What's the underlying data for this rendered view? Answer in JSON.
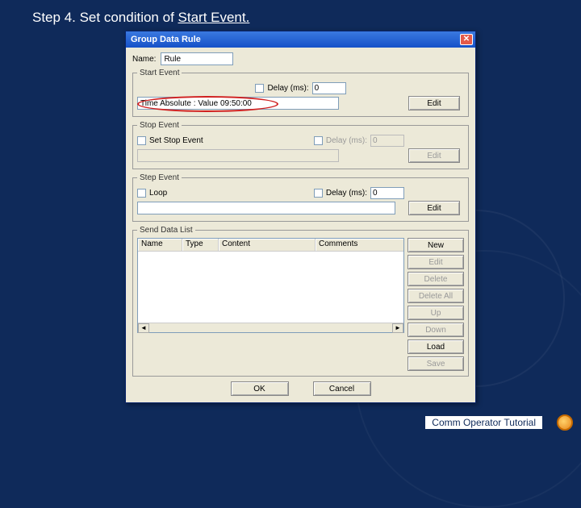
{
  "slide": {
    "title_prefix": "Step 4. Set condition of ",
    "title_highlight": "Start Event.",
    "footer": "Comm Operator Tutorial"
  },
  "dialog": {
    "title": "Group Data Rule",
    "close_glyph": "✕",
    "name_label": "Name:",
    "name_value": "Rule",
    "start_event": {
      "legend": "Start Event",
      "delay_label": "Delay (ms):",
      "delay_value": "0",
      "condition_text": "Time Absolute : Value 09:50:00",
      "edit_label": "Edit"
    },
    "stop_event": {
      "legend": "Stop Event",
      "set_label": "Set Stop Event",
      "delay_label": "Delay (ms):",
      "delay_value": "0",
      "edit_label": "Edit"
    },
    "step_event": {
      "legend": "Step Event",
      "loop_label": "Loop",
      "delay_label": "Delay (ms):",
      "delay_value": "0",
      "edit_label": "Edit"
    },
    "send_list": {
      "legend": "Send Data List",
      "cols": {
        "name": "Name",
        "type": "Type",
        "content": "Content",
        "comments": "Comments"
      },
      "buttons": {
        "new": "New",
        "edit": "Edit",
        "delete": "Delete",
        "delete_all": "Delete All",
        "up": "Up",
        "down": "Down",
        "load": "Load",
        "save": "Save"
      }
    },
    "bottom": {
      "ok": "OK",
      "cancel": "Cancel"
    }
  }
}
